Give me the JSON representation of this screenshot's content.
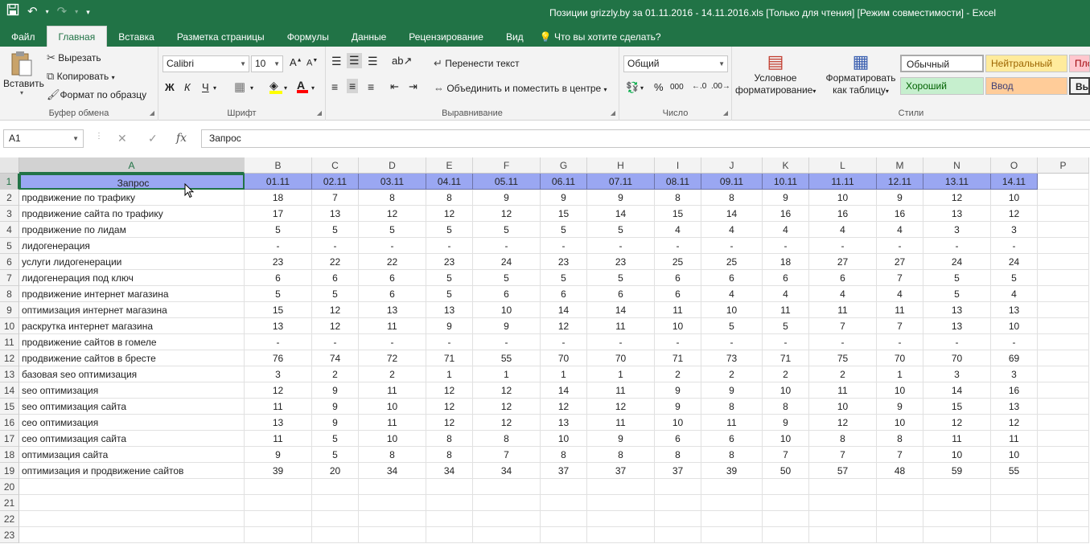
{
  "window": {
    "title": "Позиции grizzly.by за 01.11.2016 - 14.11.2016.xls  [Только для чтения]  [Режим совместимости] - Excel"
  },
  "qat": {
    "save_icon": "save-icon",
    "undo_icon": "undo-icon",
    "redo_icon": "redo-icon"
  },
  "tabs": [
    "Файл",
    "Главная",
    "Вставка",
    "Разметка страницы",
    "Формулы",
    "Данные",
    "Рецензирование",
    "Вид"
  ],
  "tell_me": "Что вы хотите сделать?",
  "ribbon": {
    "clipboard": {
      "paste": "Вставить",
      "cut": "Вырезать",
      "copy": "Копировать",
      "format_painter": "Формат по образцу",
      "label": "Буфер обмена"
    },
    "font": {
      "name": "Calibri",
      "size": "10",
      "bold": "Ж",
      "italic": "К",
      "underline": "Ч",
      "label": "Шрифт"
    },
    "alignment": {
      "wrap": "Перенести текст",
      "merge": "Объединить и поместить в центре",
      "label": "Выравнивание"
    },
    "number": {
      "format": "Общий",
      "label": "Число"
    },
    "styles": {
      "conditional": [
        "Условное",
        "форматирование"
      ],
      "as_table": [
        "Форматировать",
        "как таблицу"
      ],
      "normal": "Обычный",
      "neutral": "Нейтральный",
      "bad": "Пло",
      "good": "Хороший",
      "input": "Ввод",
      "output": "Вы",
      "label": "Стили"
    }
  },
  "formula_bar": {
    "name_box": "A1",
    "fx": "fx",
    "value": "Запрос"
  },
  "colors": {
    "accent": "#217346",
    "header_fill": "#9aa7f2",
    "good_fill": "#c6efce",
    "neutral_fill": "#ffeb9c",
    "bad_fill": "#ffc7ce",
    "input_fill": "#ffcc99"
  },
  "grid": {
    "columns": [
      "A",
      "B",
      "C",
      "D",
      "E",
      "F",
      "G",
      "H",
      "I",
      "J",
      "K",
      "L",
      "M",
      "N",
      "O",
      "P"
    ],
    "row_numbers": [
      "1",
      "2",
      "3",
      "4",
      "5",
      "6",
      "7",
      "8",
      "9",
      "10",
      "11",
      "12",
      "13",
      "14",
      "15",
      "16",
      "17",
      "18",
      "19",
      "20",
      "21",
      "22",
      "23"
    ],
    "header": [
      "Запрос",
      "01.11",
      "02.11",
      "03.11",
      "04.11",
      "05.11",
      "06.11",
      "07.11",
      "08.11",
      "09.11",
      "10.11",
      "11.11",
      "12.11",
      "13.11",
      "14.11"
    ],
    "rows": [
      [
        "продвижение по трафику",
        "18",
        "7",
        "8",
        "8",
        "9",
        "9",
        "9",
        "8",
        "8",
        "9",
        "10",
        "9",
        "12",
        "10"
      ],
      [
        "продвижение сайта по трафику",
        "17",
        "13",
        "12",
        "12",
        "12",
        "15",
        "14",
        "15",
        "14",
        "16",
        "16",
        "16",
        "13",
        "12"
      ],
      [
        "продвижение по лидам",
        "5",
        "5",
        "5",
        "5",
        "5",
        "5",
        "5",
        "4",
        "4",
        "4",
        "4",
        "4",
        "3",
        "3"
      ],
      [
        "лидогенерация",
        "-",
        "-",
        "-",
        "-",
        "-",
        "-",
        "-",
        "-",
        "-",
        "-",
        "-",
        "-",
        "-",
        "-"
      ],
      [
        "услуги лидогенерации",
        "23",
        "22",
        "22",
        "23",
        "24",
        "23",
        "23",
        "25",
        "25",
        "18",
        "27",
        "27",
        "24",
        "24"
      ],
      [
        "лидогенерация под ключ",
        "6",
        "6",
        "6",
        "5",
        "5",
        "5",
        "5",
        "6",
        "6",
        "6",
        "6",
        "7",
        "5",
        "5"
      ],
      [
        "продвижение интернет магазина",
        "5",
        "5",
        "6",
        "5",
        "6",
        "6",
        "6",
        "6",
        "4",
        "4",
        "4",
        "4",
        "5",
        "4"
      ],
      [
        "оптимизация интернет магазина",
        "15",
        "12",
        "13",
        "13",
        "10",
        "14",
        "14",
        "11",
        "10",
        "11",
        "11",
        "11",
        "13",
        "13"
      ],
      [
        "раскрутка интернет магазина",
        "13",
        "12",
        "11",
        "9",
        "9",
        "12",
        "11",
        "10",
        "5",
        "5",
        "7",
        "7",
        "13",
        "10"
      ],
      [
        "продвижение сайтов в гомеле",
        "-",
        "-",
        "-",
        "-",
        "-",
        "-",
        "-",
        "-",
        "-",
        "-",
        "-",
        "-",
        "-",
        "-"
      ],
      [
        "продвижение сайтов в бресте",
        "76",
        "74",
        "72",
        "71",
        "55",
        "70",
        "70",
        "71",
        "73",
        "71",
        "75",
        "70",
        "70",
        "69"
      ],
      [
        "базовая seo оптимизация",
        "3",
        "2",
        "2",
        "1",
        "1",
        "1",
        "1",
        "2",
        "2",
        "2",
        "2",
        "1",
        "3",
        "3"
      ],
      [
        "seo оптимизация",
        "12",
        "9",
        "11",
        "12",
        "12",
        "14",
        "11",
        "9",
        "9",
        "10",
        "11",
        "10",
        "14",
        "16"
      ],
      [
        "seo оптимизация сайта",
        "11",
        "9",
        "10",
        "12",
        "12",
        "12",
        "12",
        "9",
        "8",
        "8",
        "10",
        "9",
        "15",
        "13"
      ],
      [
        "сео оптимизация",
        "13",
        "9",
        "11",
        "12",
        "12",
        "13",
        "11",
        "10",
        "11",
        "9",
        "12",
        "10",
        "12",
        "12"
      ],
      [
        "сео оптимизация сайта",
        "11",
        "5",
        "10",
        "8",
        "8",
        "10",
        "9",
        "6",
        "6",
        "10",
        "8",
        "8",
        "11",
        "11"
      ],
      [
        "оптимизация сайта",
        "9",
        "5",
        "8",
        "8",
        "7",
        "8",
        "8",
        "8",
        "8",
        "7",
        "7",
        "7",
        "10",
        "10"
      ],
      [
        "оптимизация и продвижение сайтов",
        "39",
        "20",
        "34",
        "34",
        "34",
        "37",
        "37",
        "37",
        "39",
        "50",
        "57",
        "48",
        "59",
        "55"
      ]
    ]
  }
}
